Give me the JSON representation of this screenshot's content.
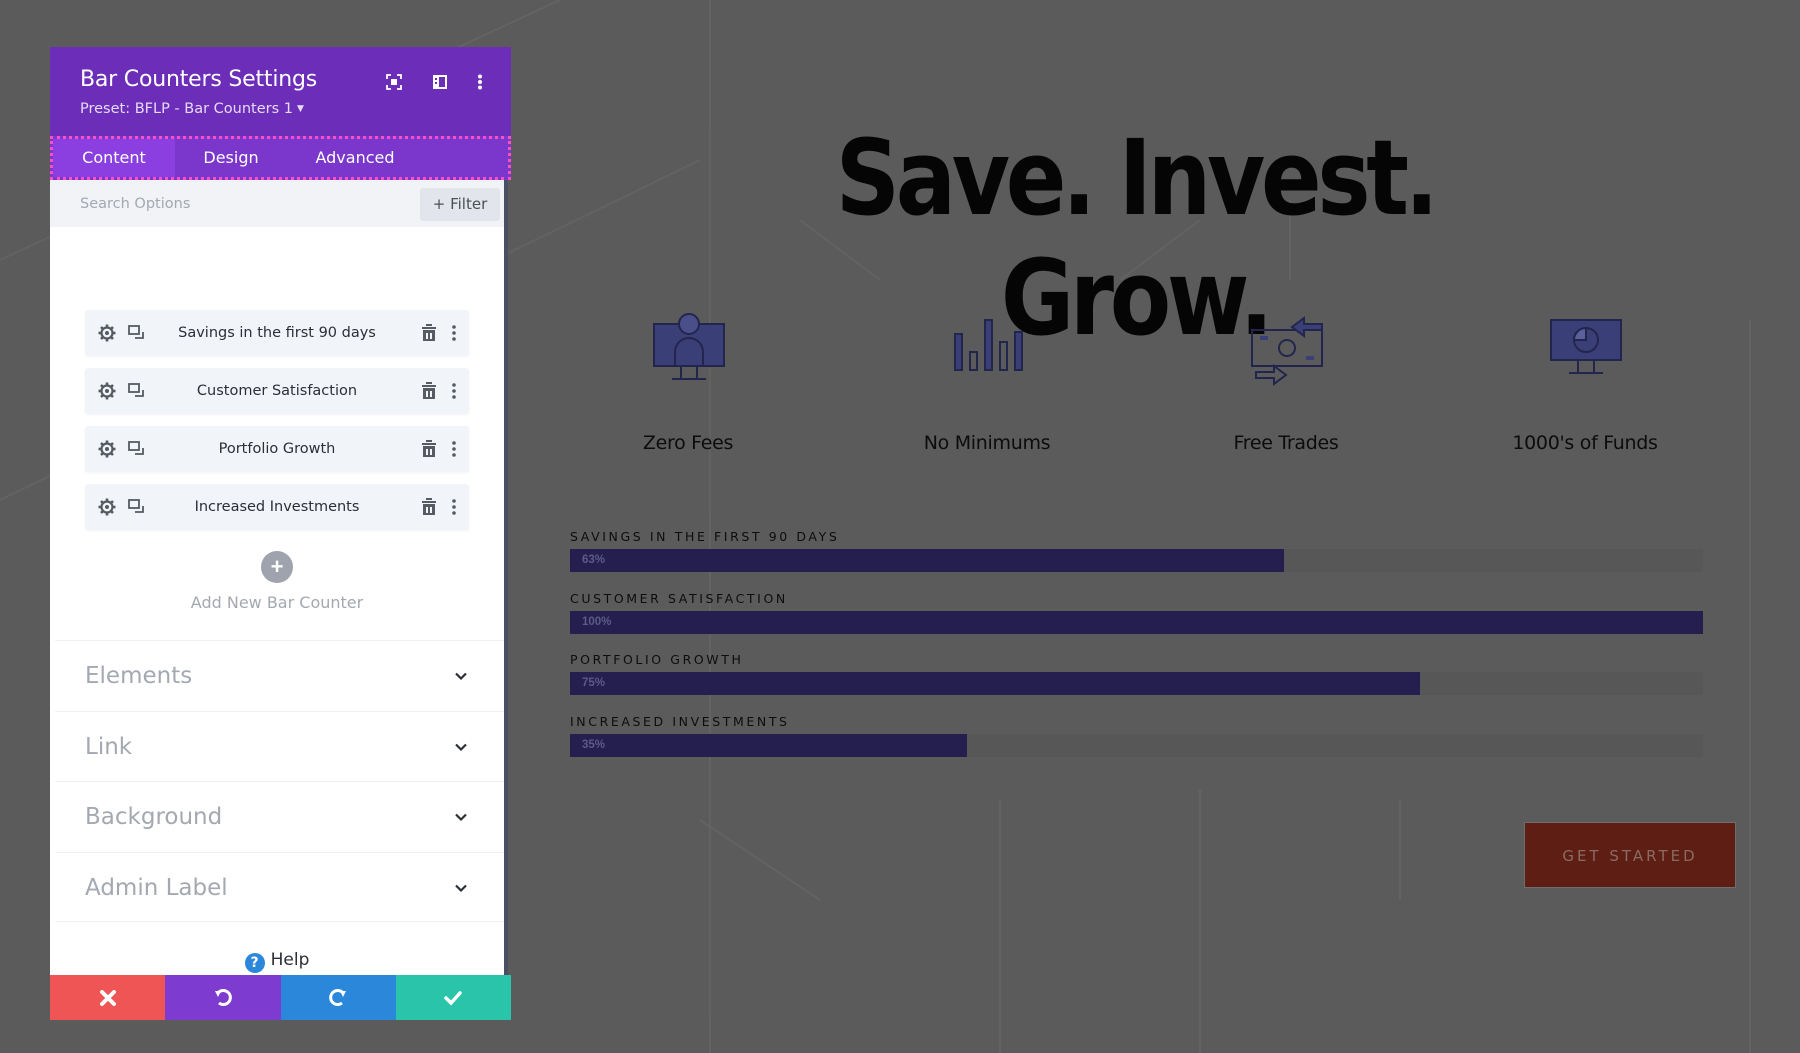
{
  "panel": {
    "title": "Bar Counters Settings",
    "preset": "Preset: BFLP - Bar Counters 1",
    "header_icons": [
      "focus-mode-icon",
      "split-view-icon",
      "more-options-icon"
    ],
    "tabs": [
      {
        "label": "Content",
        "active": true
      },
      {
        "label": "Design",
        "active": false
      },
      {
        "label": "Advanced",
        "active": false
      }
    ],
    "search": {
      "placeholder": "Search Options",
      "value": ""
    },
    "filter_label": "+ Filter",
    "items": [
      {
        "label": "Savings in the first 90 days"
      },
      {
        "label": "Customer Satisfaction"
      },
      {
        "label": "Portfolio Growth"
      },
      {
        "label": "Increased Investments"
      }
    ],
    "add_new_label": "Add New Bar Counter",
    "sections": [
      {
        "label": "Elements"
      },
      {
        "label": "Link"
      },
      {
        "label": "Background"
      },
      {
        "label": "Admin Label"
      }
    ],
    "help_label": "Help",
    "footer": {
      "cancel_color": "#ef5555",
      "undo_color": "#7e3bd0",
      "redo_color": "#2b87da",
      "save_color": "#29c4a9"
    },
    "colors": {
      "header": "#6c2eb9",
      "tabs": "#7b36cc",
      "tab_active": "#8c3fe0",
      "tab_outline": "#ff4fc6"
    }
  },
  "page": {
    "heading": "Save. Invest. Grow.",
    "features": [
      {
        "label": "Zero Fees",
        "icon": "monitor-person-icon"
      },
      {
        "label": "No Minimums",
        "icon": "bar-chart-icon"
      },
      {
        "label": "Free Trades",
        "icon": "money-exchange-icon"
      },
      {
        "label": "1000's of Funds",
        "icon": "monitor-pie-chart-icon"
      }
    ],
    "bars": [
      {
        "label": "Savings in the first 90 days",
        "percent": 63,
        "percent_label": "63%"
      },
      {
        "label": "Customer Satisfaction",
        "percent": 100,
        "percent_label": "100%"
      },
      {
        "label": "Portfolio Growth",
        "percent": 75,
        "percent_label": "75%"
      },
      {
        "label": "Increased Investments",
        "percent": 35,
        "percent_label": "35%"
      }
    ],
    "bar_color": "#241f4e",
    "cta_label": "GET STARTED",
    "cta_color": "#5e1e13"
  }
}
